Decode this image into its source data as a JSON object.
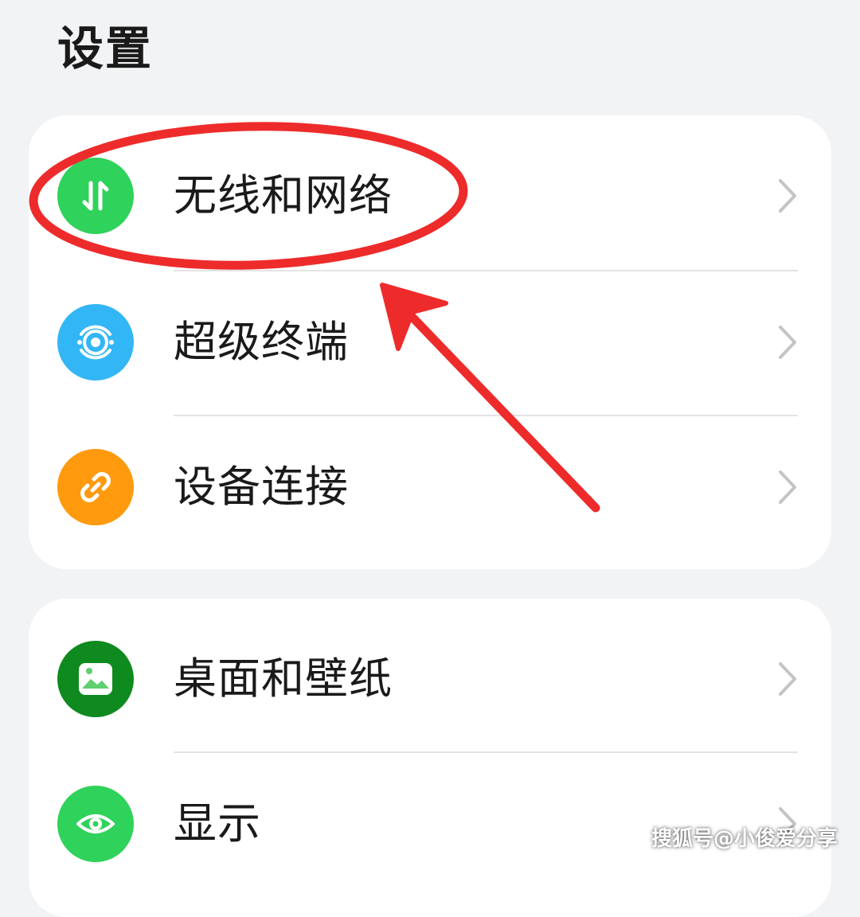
{
  "header": {
    "title": "设置"
  },
  "groups": [
    {
      "items": [
        {
          "label": "无线和网络",
          "icon": "data-transfer-icon",
          "color": "#2fd25a"
        },
        {
          "label": "超级终端",
          "icon": "super-device-icon",
          "color": "#33b6f5"
        },
        {
          "label": "设备连接",
          "icon": "link-icon",
          "color": "#ff9a0e"
        }
      ]
    },
    {
      "items": [
        {
          "label": "桌面和壁纸",
          "icon": "wallpaper-icon",
          "color": "#0f8a1f"
        },
        {
          "label": "显示",
          "icon": "eye-icon",
          "color": "#2fd25a"
        }
      ]
    }
  ],
  "annotation": {
    "color": "#ee2b2b",
    "shapes": [
      "highlight-ellipse",
      "pointer-arrow"
    ]
  },
  "watermark": "搜狐号@小俊爱分享"
}
